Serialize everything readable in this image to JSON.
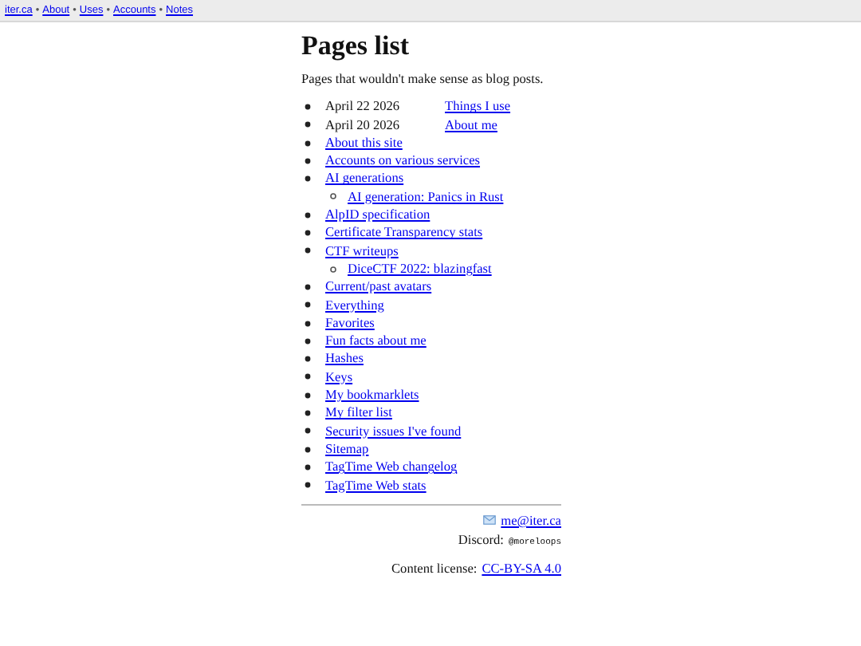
{
  "nav": {
    "separator": "•",
    "links": [
      "iter.ca",
      "About",
      "Uses",
      "Accounts",
      "Notes"
    ]
  },
  "title": "Pages list",
  "intro": "Pages that wouldn't make sense as blog posts.",
  "pages": [
    {
      "date": "April 22 2026",
      "label": "Things I use"
    },
    {
      "date": "April 20 2026",
      "label": "About me"
    },
    {
      "label": "About this site"
    },
    {
      "label": "Accounts on various services"
    },
    {
      "label": "AI generations",
      "children": [
        {
          "label": "AI generation: Panics in Rust"
        }
      ]
    },
    {
      "label": "AlpID specification"
    },
    {
      "label": "Certificate Transparency stats"
    },
    {
      "label": "CTF writeups",
      "children": [
        {
          "label": "DiceCTF 2022: blazingfast"
        }
      ]
    },
    {
      "label": "Current/past avatars"
    },
    {
      "label": "Everything"
    },
    {
      "label": "Favorites"
    },
    {
      "label": "Fun facts about me"
    },
    {
      "label": "Hashes"
    },
    {
      "label": "Keys"
    },
    {
      "label": "My bookmarklets"
    },
    {
      "label": "My filter list"
    },
    {
      "label": "Security issues I've found"
    },
    {
      "label": "Sitemap"
    },
    {
      "label": "TagTime Web changelog"
    },
    {
      "label": "TagTime Web stats"
    }
  ],
  "footer": {
    "email": "me@iter.ca",
    "discord_label": "Discord:",
    "discord_handle": "@moreloops",
    "license_label": "Content license:",
    "license": "CC-BY-SA 4.0"
  }
}
